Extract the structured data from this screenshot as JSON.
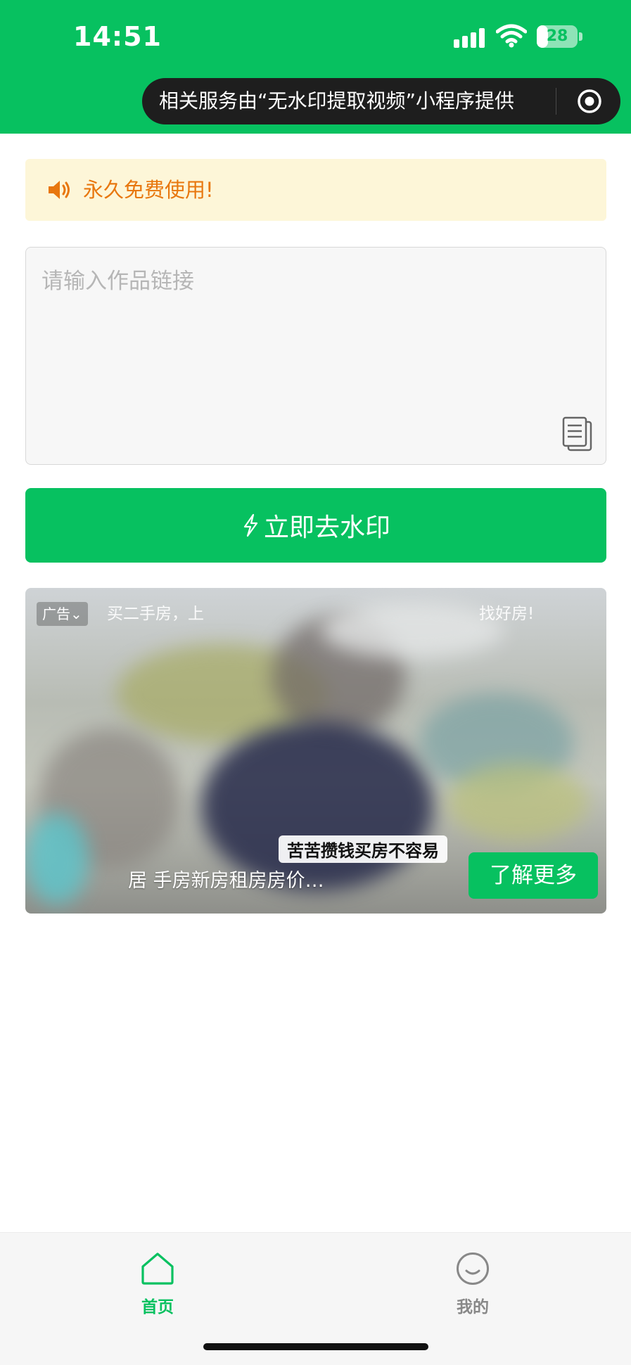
{
  "status_bar": {
    "time": "14:51",
    "battery": "28",
    "battery_level": 0.28,
    "icons": [
      "signal-icon",
      "wifi-icon",
      "battery-icon"
    ]
  },
  "capsule": {
    "text": "相关服务由“无水印提取视频”小程序提供",
    "icon": "target-circle-icon"
  },
  "notice": {
    "icon": "speaker-icon",
    "text": "永久免费使用!"
  },
  "link_input": {
    "placeholder": "请输入作品链接",
    "value": "",
    "paste_icon": "clipboard-icon"
  },
  "main_button": {
    "icon": "bolt-icon",
    "label": "立即去水印"
  },
  "ad": {
    "tag": "广告⌄",
    "top_line": "买二手房，上",
    "top_line_end": "找好房!",
    "headline": "苦苦攒钱买房不容易",
    "subline": "居          手房新房租房房价…",
    "cta": "了解更多"
  },
  "tabbar": {
    "tabs": [
      {
        "label": "首页",
        "icon": "home-icon",
        "active": true
      },
      {
        "label": "我的",
        "icon": "smiley-icon",
        "active": false
      }
    ]
  },
  "colors": {
    "brand": "#07c160",
    "notice_bg": "#fdf6d8",
    "notice_text": "#e8770e",
    "inactive_tab": "#888888"
  }
}
